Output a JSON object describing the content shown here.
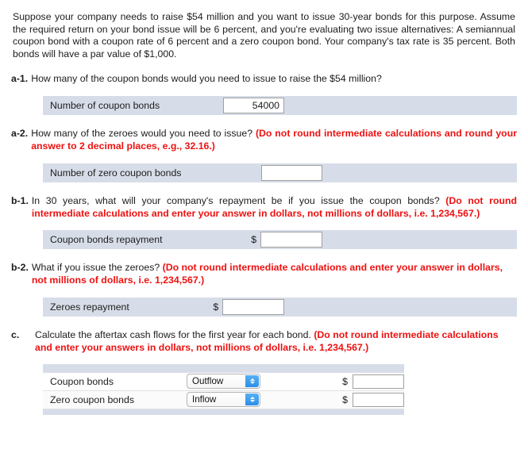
{
  "intro": "Suppose your company needs to raise $54 million and you want to issue 30-year bonds for this purpose. Assume the required return on your bond issue will be 6 percent, and you're evaluating two issue alternatives: A  semiannual coupon bond with a coupon rate of 6 percent and a zero coupon bond. Your company's tax rate is 35 percent. Both bonds will have a par value of $1,000.",
  "questions": {
    "a1": {
      "label": "a-1.",
      "text": "How many of the coupon bonds would you need to issue to raise the $54 million?",
      "note": "",
      "row_label": "Number of coupon bonds",
      "value": "54000",
      "placeholder": ""
    },
    "a2": {
      "label": "a-2.",
      "text": "How many of the zeroes would you need to issue? ",
      "note": "(Do not round intermediate calculations and round your answer to 2 decimal places, e.g., 32.16.)",
      "row_label": "Number of zero coupon bonds",
      "value": "",
      "placeholder": ""
    },
    "b1": {
      "label": "b-1.",
      "text": "In 30 years, what will your company's repayment be if you issue the coupon bonds? ",
      "note": "(Do not round intermediate calculations and enter your answer in dollars, not millions of dollars, i.e. 1,234,567.)",
      "row_label": "Coupon bonds repayment",
      "dollar": "$",
      "value": "",
      "placeholder": ""
    },
    "b2": {
      "label": "b-2.",
      "text": "What if you issue the zeroes? ",
      "note": "(Do not round intermediate calculations and enter your answer in dollars, not millions of dollars, i.e. 1,234,567.)",
      "row_label": "Zeroes repayment",
      "dollar": "$",
      "value": "",
      "placeholder": ""
    },
    "c": {
      "label": "c.",
      "text": "Calculate the aftertax cash flows for the first year for each bond. ",
      "note": "(Do not round intermediate calculations and enter your answers in dollars, not millions of dollars, i.e. 1,234,567.)",
      "rows": [
        {
          "name": "Coupon bonds",
          "selected": "Outflow",
          "options": [
            "Outflow",
            "Inflow"
          ],
          "dollar": "$",
          "value": "",
          "placeholder": ""
        },
        {
          "name": "Zero coupon bonds",
          "selected": "Inflow",
          "options": [
            "Outflow",
            "Inflow"
          ],
          "dollar": "$",
          "value": "",
          "placeholder": ""
        }
      ]
    }
  },
  "colors": {
    "note_red": "#ee1111",
    "band": "#d7dde8",
    "stepper_blue": "#2b8fe8",
    "text": "#1c1c1c"
  }
}
